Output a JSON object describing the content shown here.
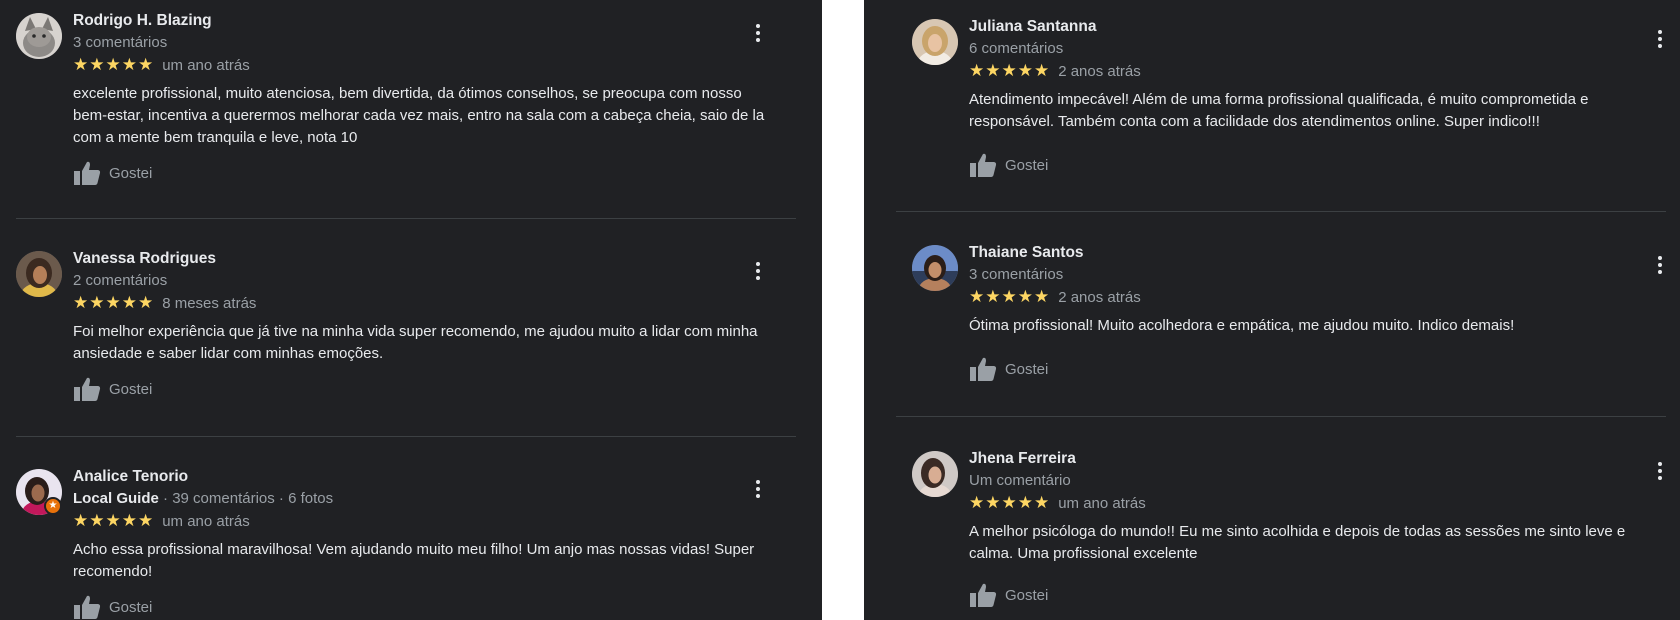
{
  "left_reviews": [
    {
      "name": "Rodrigo H. Blazing",
      "meta": "3 comentários",
      "stars": "★★★★★",
      "time": "um ano atrás",
      "text": "excelente profissional, muito atenciosa, bem divertida, da ótimos conselhos, se preocupa com nosso bem-estar, incentiva a querermos melhorar cada vez mais, entro na sala com a cabeça cheia, saio de la com a mente bem tranquila e leve, nota 10",
      "like_label": "Gostei",
      "avatar_icon": "cat-photo-avatar"
    },
    {
      "name": "Vanessa Rodrigues",
      "meta": "2 comentários",
      "stars": "★★★★★",
      "time": "8 meses atrás",
      "text": "Foi melhor experiência que já tive na minha vida super recomendo, me ajudou muito a lidar com minha ansiedade e saber lidar com minhas emoções.",
      "like_label": "Gostei",
      "avatar_icon": "person-photo-avatar"
    },
    {
      "name": "Analice Tenorio",
      "local_guide": "Local Guide",
      "meta": " · 39 comentários · 6 fotos",
      "stars": "★★★★★",
      "time": "um ano atrás",
      "text": "Acho essa profissional maravilhosa! Vem ajudando muito meu filho! Um anjo mas nossas vidas! Super recomendo!",
      "like_label": "Gostei",
      "avatar_icon": "person-photo-avatar",
      "badge_icon": "local-guide-star-icon"
    }
  ],
  "right_reviews": [
    {
      "name": "Juliana Santanna",
      "meta": "6 comentários",
      "stars": "★★★★★",
      "time": "2 anos atrás",
      "text": "Atendimento impecável! Além de uma forma profissional qualificada, é muito comprometida e responsável. Também conta com a facilidade dos atendimentos online. Super indico!!!",
      "like_label": "Gostei",
      "avatar_icon": "person-photo-avatar"
    },
    {
      "name": "Thaiane Santos",
      "meta": "3 comentários",
      "stars": "★★★★★",
      "time": "2 anos atrás",
      "text": "Ótima profissional! Muito acolhedora e empática, me ajudou muito. Indico demais!",
      "like_label": "Gostei",
      "avatar_icon": "person-photo-avatar"
    },
    {
      "name": "Jhena Ferreira",
      "meta": "Um comentário",
      "stars": "★★★★★",
      "time": "um ano atrás",
      "text": "A melhor psicóloga do mundo!! Eu me sinto acolhida e depois de todas as sessões me sinto leve e calma. Uma profissional excelente",
      "like_label": "Gostei",
      "avatar_icon": "person-photo-avatar"
    }
  ],
  "colors": {
    "background": "#202124",
    "star": "#fdd663",
    "primary_text": "#e8eaed",
    "secondary_text": "#9aa0a6",
    "divider": "#3c4043"
  }
}
